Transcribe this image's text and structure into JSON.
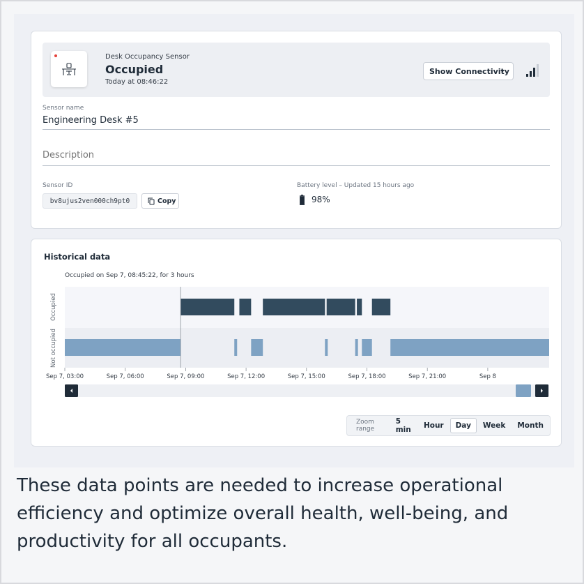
{
  "sensor": {
    "type_label": "Desk Occupancy Sensor",
    "state": "Occupied",
    "timestamp": "Today at 08:46:22",
    "connectivity_button": "Show Connectivity",
    "signal_bars": 3,
    "signal_bars_total": 4
  },
  "fields": {
    "name_label": "Sensor name",
    "name_value": "Engineering Desk #5",
    "description_placeholder": "Description",
    "id_label": "Sensor ID",
    "id_value": "bv8ujus2ven000ch9pt0",
    "copy_button": "Copy",
    "battery_label": "Battery level – Updated 15 hours ago",
    "battery_value": "98%",
    "battery_level": 0.98
  },
  "history": {
    "title": "Historical data",
    "tooltip": "Occupied on Sep 7, 08:45:22, for 3 hours",
    "zoom_label": "Zoom range",
    "zoom_options": [
      "5 min",
      "Hour",
      "Day",
      "Week",
      "Month"
    ],
    "zoom_selected": "Day"
  },
  "chart_data": {
    "type": "timeline",
    "rows": [
      "Occupied",
      "Not occupied"
    ],
    "x_range": [
      "Sep 7, 00:00",
      "Sep 8, 09:00"
    ],
    "x_ticks": [
      "Sep 7, 03:00",
      "Sep 7, 06:00",
      "Sep 7, 09:00",
      "Sep 7, 12:00",
      "Sep 7, 15:00",
      "Sep 7, 18:00",
      "Sep 7, 21:00",
      "Sep 8"
    ],
    "cursor_time": "Sep 7, 08:45",
    "occupied": [
      {
        "start": "Sep 7, 08:45",
        "end": "Sep 7, 11:25"
      },
      {
        "start": "Sep 7, 11:40",
        "end": "Sep 7, 12:15"
      },
      {
        "start": "Sep 7, 12:50",
        "end": "Sep 7, 15:55"
      },
      {
        "start": "Sep 7, 16:00",
        "end": "Sep 7, 17:25"
      },
      {
        "start": "Sep 7, 17:30",
        "end": "Sep 7, 17:45"
      },
      {
        "start": "Sep 7, 18:15",
        "end": "Sep 7, 19:10"
      }
    ],
    "not_occupied": [
      {
        "start": "Sep 7, 03:00",
        "end": "Sep 7, 08:45"
      },
      {
        "start": "Sep 7, 11:25",
        "end": "Sep 7, 11:30"
      },
      {
        "start": "Sep 7, 12:15",
        "end": "Sep 7, 12:50"
      },
      {
        "start": "Sep 7, 15:55",
        "end": "Sep 7, 16:00"
      },
      {
        "start": "Sep 7, 17:25",
        "end": "Sep 7, 17:30"
      },
      {
        "start": "Sep 7, 17:45",
        "end": "Sep 7, 18:15"
      },
      {
        "start": "Sep 7, 19:10",
        "end": "Sep 8, 09:00"
      }
    ]
  },
  "caption": "These data points are needed to increase operational efficiency and optimize overall health, well-being, and productivity for all occupants.",
  "colors": {
    "occupied": "#324b5e",
    "not_occupied": "#7ea2c3",
    "status_dot": "#e5413a"
  }
}
